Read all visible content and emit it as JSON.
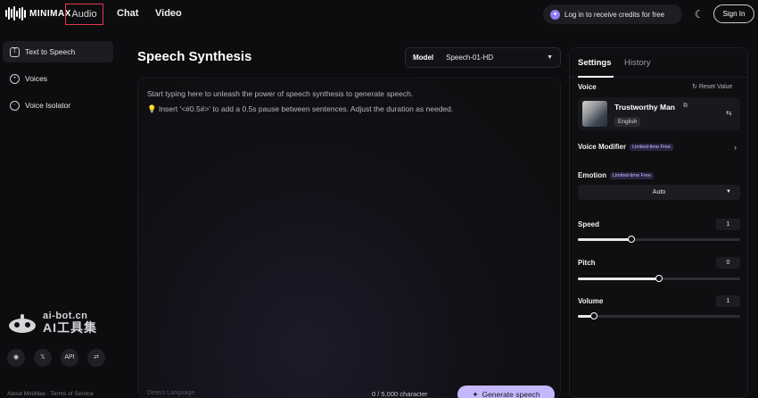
{
  "header": {
    "brand": "MINIMAX",
    "nav": [
      {
        "label": "Audio"
      },
      {
        "label": "Chat"
      },
      {
        "label": "Video"
      }
    ],
    "credits_text": "Log in to receive credits for free",
    "signin_label": "Sign In"
  },
  "sidebar": {
    "items": [
      {
        "label": "Text to Speech",
        "icon": "text-to-speech-icon"
      },
      {
        "label": "Voices",
        "icon": "voices-icon"
      },
      {
        "label": "Voice Isolator",
        "icon": "voice-isolator-icon"
      }
    ],
    "watermark_top": "ai-bot.cn",
    "watermark_bottom": "AI工具集",
    "socials": [
      "discord-icon",
      "x-icon",
      "API",
      "feedback-icon"
    ],
    "footer_links": "About MiniMax  ·  Terms of Service"
  },
  "main": {
    "title": "Speech Synthesis",
    "model_label": "Model",
    "model_value": "Speech-01-HD",
    "placeholder_line1": "Start typing here to unleash the power of speech synthesis to generate speech.",
    "placeholder_line2": "Insert '<#0.5#>' to add a 0.5s pause between sentences. Adjust the duration as needed.",
    "detect_language": "Detect Language",
    "char_count": "0 / 5,000 character",
    "generate_label": "Generate speech"
  },
  "settings": {
    "tabs": [
      {
        "label": "Settings"
      },
      {
        "label": "History"
      }
    ],
    "voice_label": "Voice",
    "reset_label": "Reset Value",
    "voice_name": "Trustworthy Man",
    "voice_lang": "English",
    "modifier_label": "Voice Modifier",
    "badge": "Limited-time Free",
    "emotion_label": "Emotion",
    "emotion_value": "Auto",
    "speed_label": "Speed",
    "speed_value": "1",
    "speed_level": 0.33,
    "pitch_label": "Pitch",
    "pitch_value": "0",
    "pitch_level": 0.5,
    "volume_label": "Volume",
    "volume_value": "1",
    "volume_level": 0.1
  },
  "colors": {
    "accent": "#c6b8ff",
    "background": "#0d0d10",
    "highlight_border": "#e23a4a"
  }
}
